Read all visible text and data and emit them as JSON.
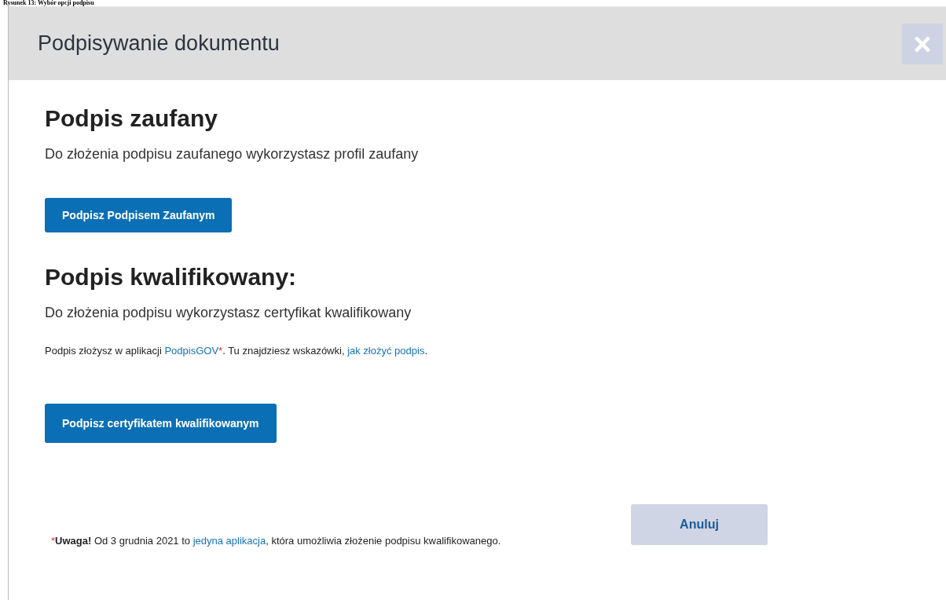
{
  "caption": "Rysunek 13: Wybór opcji podpisu",
  "dialog": {
    "title": "Podpisywanie dokumentu",
    "close_label": "×",
    "sections": [
      {
        "heading": "Podpis zaufany",
        "description": "Do złożenia podpisu zaufanego wykorzystasz profil zaufany",
        "button": "Podpisz Podpisem Zaufanym"
      },
      {
        "heading": "Podpis kwalifikowany:",
        "description": "Do złożenia podpisu wykorzystasz certyfikat kwalifikowany",
        "note": [
          {
            "kind": "plain",
            "text": "Podpis złożysz w aplikacji "
          },
          {
            "kind": "link",
            "text": "PodpisGOV"
          },
          {
            "kind": "mark",
            "text": "*"
          },
          {
            "kind": "plain",
            "text": ". Tu znajdziesz wskazówki, "
          },
          {
            "kind": "link",
            "text": "jak złożyć podpis"
          },
          {
            "kind": "plain",
            "text": "."
          }
        ],
        "button": "Podpisz certyfikatem kwalifikowanym"
      }
    ],
    "footer_note": [
      {
        "kind": "mark",
        "text": "*"
      },
      {
        "kind": "bold",
        "text": "Uwaga!"
      },
      {
        "kind": "plain",
        "text": " Od 3 grudnia 2021 to "
      },
      {
        "kind": "link",
        "text": "jedyna aplikacja"
      },
      {
        "kind": "plain",
        "text": ", która umożliwia złożenie podpisu kwalifikowanego."
      }
    ],
    "cancel_button": "Anuluj"
  }
}
